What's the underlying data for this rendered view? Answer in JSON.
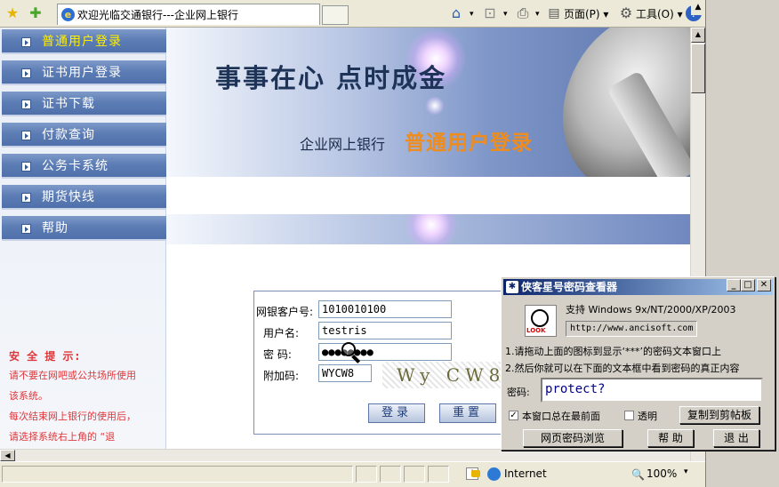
{
  "browser": {
    "tab_title": "欢迎光临交通银行---企业网上银行",
    "toolbar": {
      "home_icon": "home-icon",
      "feeds_icon": "rss-icon",
      "print_icon": "printer-icon",
      "page_menu": "页面(P)",
      "tools_menu": "工具(O)",
      "help_icon": "help-icon"
    },
    "status_bar": {
      "zone": "Internet",
      "zoom": "100%"
    }
  },
  "page": {
    "sidebar": {
      "items": [
        {
          "label": "普通用户登录",
          "active": true
        },
        {
          "label": "证书用户登录"
        },
        {
          "label": "证书下载"
        },
        {
          "label": "付款查询"
        },
        {
          "label": "公务卡系统"
        },
        {
          "label": "期货快线"
        },
        {
          "label": "帮助"
        }
      ],
      "tips": {
        "heading": "安 全 提 示:",
        "lines": [
          "请不要在网吧或公共场所使用",
          "该系统。",
          "每次结束网上银行的使用后，",
          "请选择系统右上角的 “退"
        ]
      }
    },
    "banner": {
      "slogan": "事事在心  点时成金",
      "subtitle": "企业网上银行",
      "highlight": "普通用户登录"
    },
    "login": {
      "account_label": "网银客户号:",
      "account_value": "1010010100",
      "username_label": "用户名:",
      "username_value": "testris",
      "password_label": "密  码:",
      "password_value": "●●●●●●●●",
      "captcha_label": "附加码:",
      "captcha_value": "WYCW8",
      "captcha_image_text": "Wy CW8",
      "login_button": "登录",
      "reset_button": "重置"
    }
  },
  "dialog": {
    "title": "侠客星号密码查看器",
    "support_text": "支持 Windows 9x/NT/2000/XP/2003",
    "url": "http://www.ancisoft.com",
    "step1": "1.请拖动上面的图标到显示‘***’的密码文本窗口上",
    "step2": "2.然后你就可以在下面的文本框中看到密码的真正内容",
    "password_label": "密码:",
    "password_value": "protect?",
    "always_on_top": "本窗口总在最前面",
    "always_on_top_checked": true,
    "transparent": "透明",
    "transparent_checked": false,
    "copy_button": "复制到剪帖板",
    "browse_button": "网页密码浏览",
    "help_button": "帮 助",
    "exit_button": "退 出",
    "icon_tag": "LOOK"
  }
}
